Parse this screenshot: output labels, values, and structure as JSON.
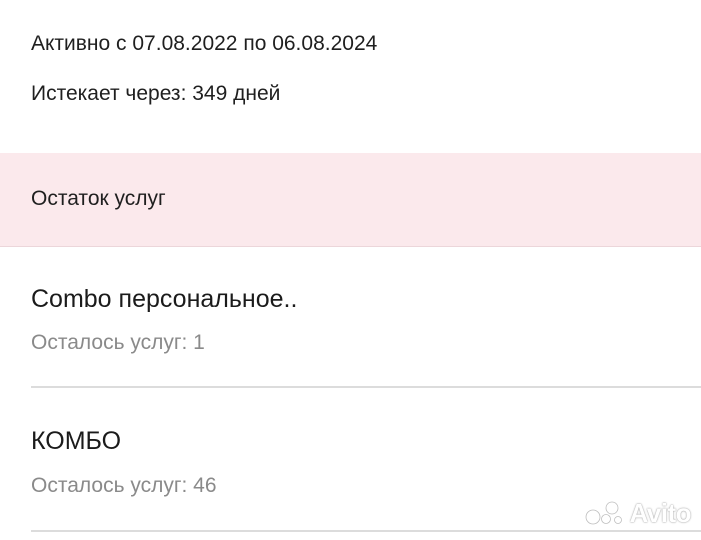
{
  "membership": {
    "active_period": "Активно с 07.08.2022 по 06.08.2024",
    "expires_in": "Истекает через: 349 дней"
  },
  "remaining_section": {
    "title": "Остаток услуг",
    "background_color": "#fbe9ec"
  },
  "services": [
    {
      "name": "Combo персональное..",
      "remaining": "Осталось услуг: 1"
    },
    {
      "name": "КОМБО",
      "remaining": "Осталось услуг: 46"
    }
  ],
  "watermark": {
    "text": "Avito",
    "icon": "avito-logo-icon"
  }
}
